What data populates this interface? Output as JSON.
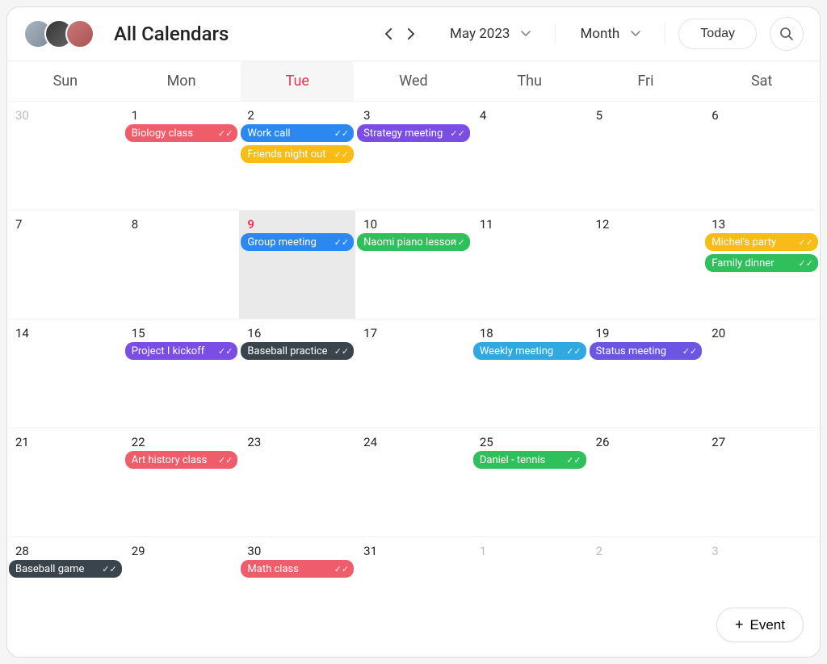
{
  "header": {
    "title": "All Calendars",
    "month_label": "May 2023",
    "view_label": "Month",
    "today_label": "Today"
  },
  "daynames": [
    "Sun",
    "Mon",
    "Tue",
    "Wed",
    "Thu",
    "Fri",
    "Sat"
  ],
  "selected_day_index": 2,
  "today_cell": "9",
  "add_event_label": "Event",
  "colors": {
    "red": "#f05d6a",
    "blue": "#2b88f0",
    "yellow": "#f7bd16",
    "purple": "#7a4de5",
    "green": "#2fbf5b",
    "cyan": "#2fa9e0",
    "dark": "#3a444c",
    "violet": "#6d55e4"
  },
  "weeks": [
    [
      {
        "n": "30",
        "other": true,
        "events": []
      },
      {
        "n": "1",
        "events": [
          {
            "label": "Biology class",
            "color": "red"
          }
        ]
      },
      {
        "n": "2",
        "events": [
          {
            "label": "Work call",
            "color": "blue"
          },
          {
            "label": "Friends night out",
            "color": "yellow"
          }
        ]
      },
      {
        "n": "3",
        "events": [
          {
            "label": "Strategy meeting",
            "color": "purple"
          }
        ]
      },
      {
        "n": "4",
        "events": []
      },
      {
        "n": "5",
        "events": []
      },
      {
        "n": "6",
        "events": []
      }
    ],
    [
      {
        "n": "7",
        "events": []
      },
      {
        "n": "8",
        "events": []
      },
      {
        "n": "9",
        "today": true,
        "events": [
          {
            "label": "Group meeting",
            "color": "blue"
          }
        ]
      },
      {
        "n": "10",
        "events": [
          {
            "label": "Naomi piano lesson",
            "color": "green"
          }
        ]
      },
      {
        "n": "11",
        "events": []
      },
      {
        "n": "12",
        "events": []
      },
      {
        "n": "13",
        "events": [
          {
            "label": "Michel's party",
            "color": "yellow"
          },
          {
            "label": "Family dinner",
            "color": "green"
          }
        ]
      }
    ],
    [
      {
        "n": "14",
        "events": []
      },
      {
        "n": "15",
        "events": [
          {
            "label": "Project I kickoff",
            "color": "purple"
          }
        ]
      },
      {
        "n": "16",
        "events": [
          {
            "label": "Baseball practice",
            "color": "dark"
          }
        ]
      },
      {
        "n": "17",
        "events": []
      },
      {
        "n": "18",
        "events": [
          {
            "label": "Weekly meeting",
            "color": "cyan"
          }
        ]
      },
      {
        "n": "19",
        "events": [
          {
            "label": "Status meeting",
            "color": "violet"
          }
        ]
      },
      {
        "n": "20",
        "events": []
      }
    ],
    [
      {
        "n": "21",
        "events": []
      },
      {
        "n": "22",
        "events": [
          {
            "label": "Art history class",
            "color": "red"
          }
        ]
      },
      {
        "n": "23",
        "events": []
      },
      {
        "n": "24",
        "events": []
      },
      {
        "n": "25",
        "events": [
          {
            "label": "Daniel - tennis",
            "color": "green"
          }
        ]
      },
      {
        "n": "26",
        "events": []
      },
      {
        "n": "27",
        "events": []
      }
    ],
    [
      {
        "n": "28",
        "events": [
          {
            "label": "Baseball game",
            "color": "dark"
          }
        ]
      },
      {
        "n": "29",
        "events": []
      },
      {
        "n": "30",
        "events": [
          {
            "label": "Math class",
            "color": "red"
          }
        ]
      },
      {
        "n": "31",
        "events": []
      },
      {
        "n": "1",
        "other": true,
        "events": []
      },
      {
        "n": "2",
        "other": true,
        "events": []
      },
      {
        "n": "3",
        "other": true,
        "events": []
      }
    ]
  ]
}
